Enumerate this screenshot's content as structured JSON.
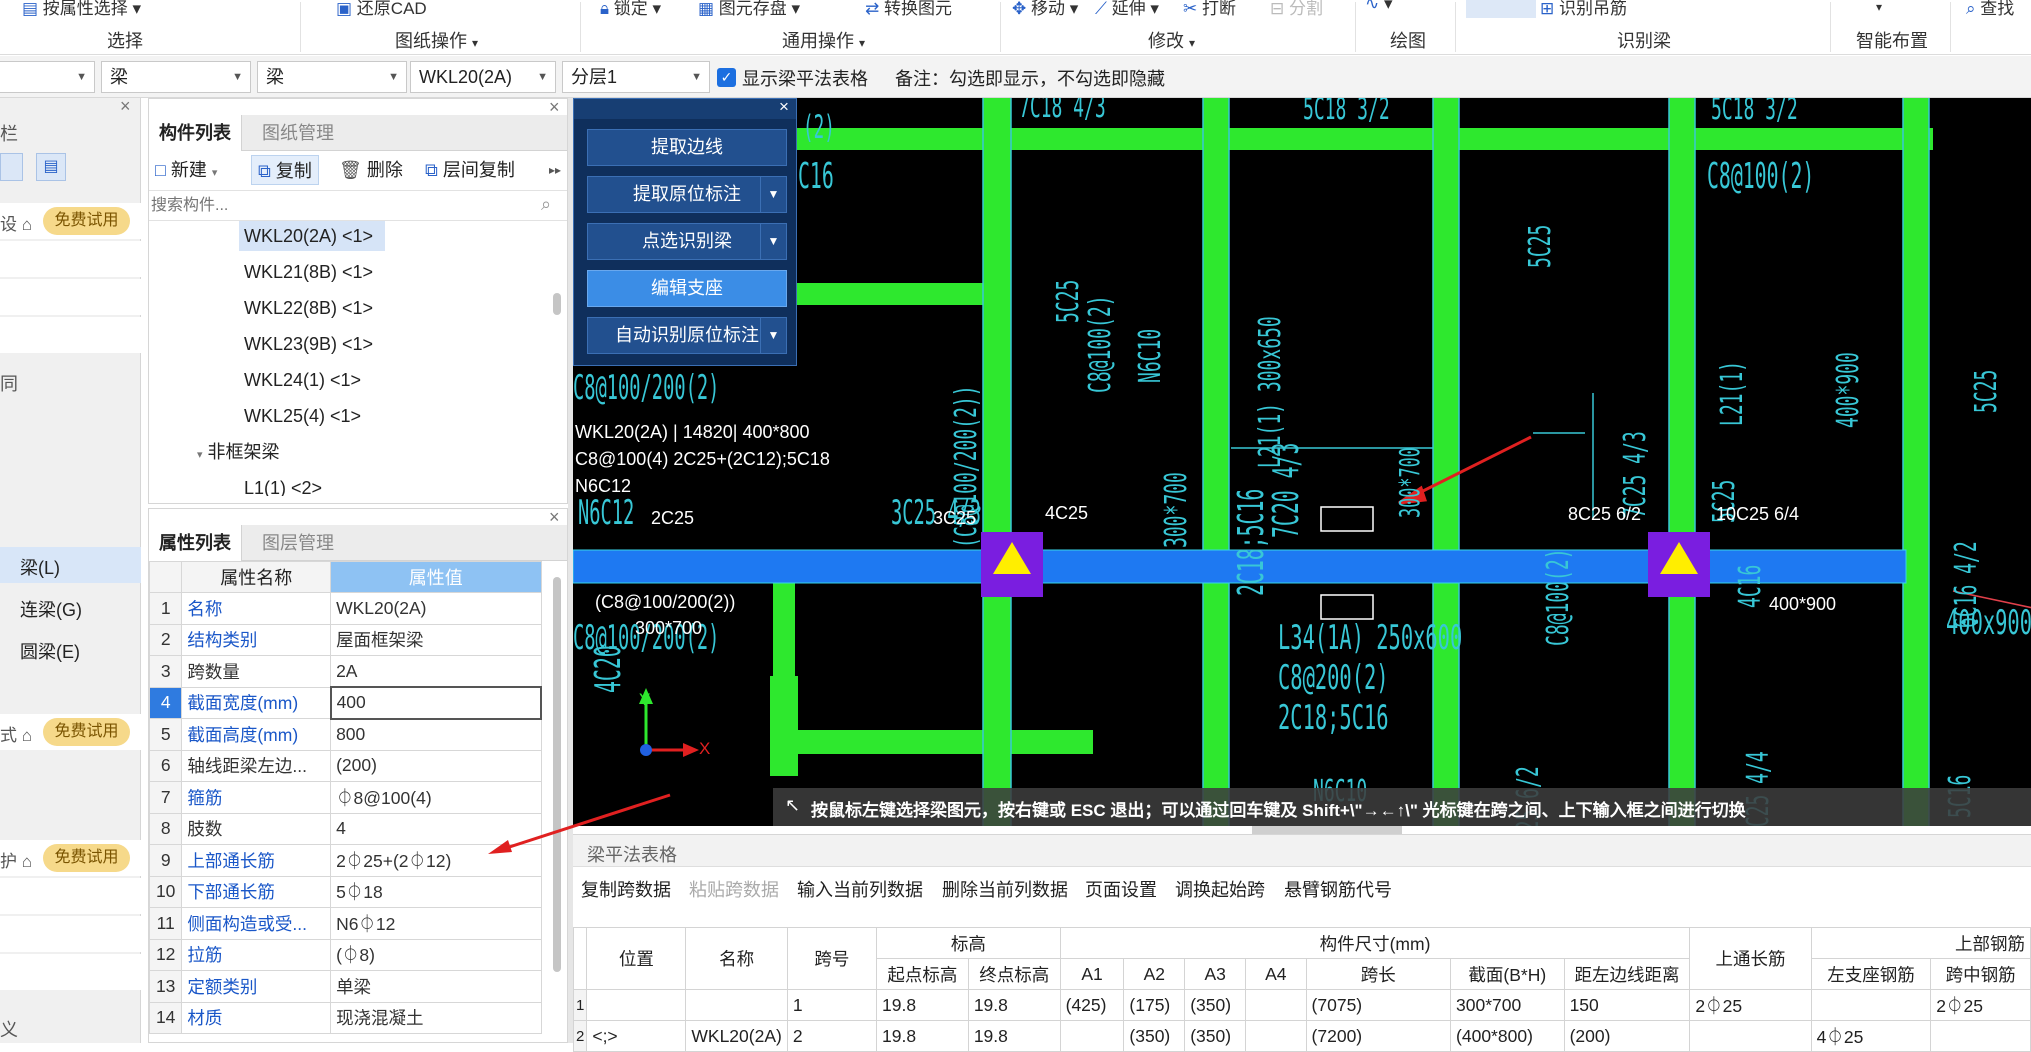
{
  "ribbon": {
    "top_items": [
      "按属性选择",
      "还原CAD",
      "锁定",
      "图元存盘",
      "转换图元",
      "移动",
      "延伸",
      "打断",
      "分割",
      "识别吊筋",
      "查找"
    ],
    "groups": [
      "选择",
      "图纸操作",
      "通用操作",
      "修改",
      "绘图",
      "识别梁",
      "智能布置"
    ]
  },
  "toolbar2": {
    "combo1": "",
    "combo2": "梁",
    "combo3": "梁",
    "combo4": "WKL20(2A)",
    "combo5": "分层1",
    "checkbox_label": "显示梁平法表格",
    "note": "备注：勾选即显示，不勾选即隐藏"
  },
  "left": {
    "title": "栏",
    "badge": "免费试用",
    "items": [
      "梁(L)",
      "连梁(G)",
      "圆梁(E)"
    ],
    "frag1": "同",
    "frag2": "义"
  },
  "comp_panel": {
    "tabs": [
      "构件列表",
      "图纸管理"
    ],
    "tools": [
      "新建",
      "复制",
      "删除",
      "层间复制"
    ],
    "search_placeholder": "搜索构件...",
    "items": [
      "WKL20(2A) <1>",
      "WKL21(8B) <1>",
      "WKL22(8B) <1>",
      "WKL23(9B) <1>",
      "WKL24(1) <1>",
      "WKL25(4) <1>"
    ],
    "category": "非框架梁",
    "partial_item": "L1(1) <2>"
  },
  "prop_panel": {
    "tabs": [
      "属性列表",
      "图层管理"
    ],
    "headers": [
      "属性名称",
      "属性值"
    ],
    "rows": [
      {
        "n": "1",
        "name": "名称",
        "value": "WKL20(2A)",
        "blue": true
      },
      {
        "n": "2",
        "name": "结构类别",
        "value": "屋面框架梁",
        "blue": true
      },
      {
        "n": "3",
        "name": "跨数量",
        "value": "2A",
        "blue": false
      },
      {
        "n": "4",
        "name": "截面宽度(mm)",
        "value": "400",
        "blue": true
      },
      {
        "n": "5",
        "name": "截面高度(mm)",
        "value": "800",
        "blue": true
      },
      {
        "n": "6",
        "name": "轴线距梁左边...",
        "value": "(200)",
        "blue": false
      },
      {
        "n": "7",
        "name": "箍筋",
        "value": "⏀8@100(4)",
        "blue": true
      },
      {
        "n": "8",
        "name": "肢数",
        "value": "4",
        "blue": false
      },
      {
        "n": "9",
        "name": "上部通长筋",
        "value": "2⏀25+(2⏀12)",
        "blue": true
      },
      {
        "n": "10",
        "name": "下部通长筋",
        "value": "5⏀18",
        "blue": true
      },
      {
        "n": "11",
        "name": "侧面构造或受...",
        "value": "N6⏀12",
        "blue": true
      },
      {
        "n": "12",
        "name": "拉筋",
        "value": "(⏀8)",
        "blue": true
      },
      {
        "n": "13",
        "name": "定额类别",
        "value": "单梁",
        "blue": true
      },
      {
        "n": "14",
        "name": "材质",
        "value": "现浇混凝土",
        "blue": true
      }
    ]
  },
  "float_menu": {
    "buttons": [
      "提取边线",
      "提取原位标注",
      "点选识别梁",
      "编辑支座",
      "自动识别原位标注"
    ]
  },
  "cad": {
    "texts": [
      "WKL20(2A) | 14820| 400*800",
      "C8@100(4) 2C25+(2C12);5C18",
      "N6C12",
      "2C25",
      "3C25",
      "4C25",
      "8C25 6/2",
      "10C25 6/4",
      "(C8@100/200(2))",
      "300*700",
      "400*900",
      "C8@100(2)",
      "C8@100(2)",
      "L21(1) 300x650",
      "L21(1)",
      "5C25",
      "5C25",
      "4C16",
      "7C25 4/3",
      "6C16 4/2",
      "6C25 4/2",
      "L34(1A) 250x600",
      "C8@200(2)",
      "2C18;5C16",
      "8C25 6/2",
      "8C25 4/4",
      "5C16",
      "400x900",
      "C8@100/200(2)",
      "300x700",
      "3C25 4/3",
      "(2)",
      "C16",
      "N6C10",
      "7C20 4/3",
      "4C20",
      "5C18 3/2",
      "7C18 4/3"
    ],
    "status": "按鼠标左键选择梁图元，按右键或 ESC 退出；可以通过回车键及 Shift+\\\"→←↑\\\" 光标键在跨之间、上下输入框之间进行切换",
    "axis_x": "X",
    "axis_y": "Y"
  },
  "bottom": {
    "title": "梁平法表格",
    "tools": [
      "复制跨数据",
      "粘贴跨数据",
      "输入当前列数据",
      "删除当前列数据",
      "页面设置",
      "调换起始跨",
      "悬臂钢筋代号"
    ],
    "h_top": [
      "位置",
      "名称",
      "跨号",
      "标高",
      "构件尺寸(mm)",
      "上通长筋",
      "上部钢筋"
    ],
    "h_sub": [
      "起点标高",
      "终点标高",
      "A1",
      "A2",
      "A3",
      "A4",
      "跨长",
      "截面(B*H)",
      "距左边线距离",
      "左支座钢筋",
      "跨中钢筋"
    ],
    "rows": [
      {
        "n": "1",
        "pos": "",
        "name": "",
        "span": "1",
        "s": "19.8",
        "e": "19.8",
        "a1": "(425)",
        "a2": "(175)",
        "a3": "(350)",
        "a4": "",
        "len": "(7075)",
        "sec": "300*700",
        "dist": "150",
        "top": "2⏀25",
        "left": "",
        "mid": "2⏀25"
      },
      {
        "n": "2",
        "pos": "<;>",
        "name": "WKL20(2A)",
        "span": "2",
        "s": "19.8",
        "e": "19.8",
        "a1": "",
        "a2": "(350)",
        "a3": "(350)",
        "a4": "",
        "len": "(7200)",
        "sec": "(400*800)",
        "dist": "(200)",
        "top": "",
        "left": "4⏀25",
        "mid": ""
      }
    ]
  }
}
